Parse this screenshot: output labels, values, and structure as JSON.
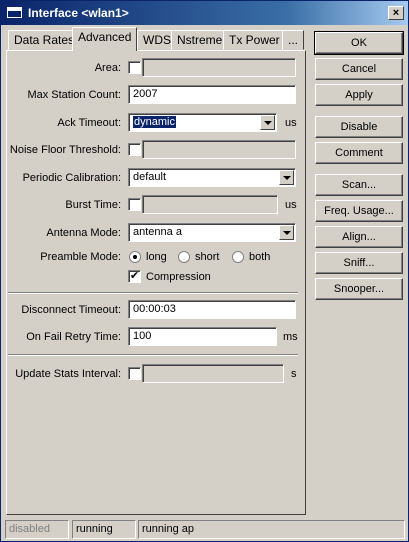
{
  "window": {
    "title": "Interface <wlan1>",
    "close_glyph": "×"
  },
  "tabs": [
    {
      "label": "Data Rates"
    },
    {
      "label": "Advanced"
    },
    {
      "label": "WDS"
    },
    {
      "label": "Nstreme"
    },
    {
      "label": "Tx Power"
    },
    {
      "label": "..."
    }
  ],
  "active_tab": "Advanced",
  "form": {
    "area": {
      "label": "Area:",
      "value": ""
    },
    "max_station_count": {
      "label": "Max Station Count:",
      "value": "2007"
    },
    "ack_timeout": {
      "label": "Ack Timeout:",
      "value": "dynamic",
      "unit": "us"
    },
    "noise_floor_threshold": {
      "label": "Noise Floor Threshold:",
      "value": ""
    },
    "periodic_calibration": {
      "label": "Periodic Calibration:",
      "value": "default"
    },
    "burst_time": {
      "label": "Burst Time:",
      "value": "",
      "unit": "us"
    },
    "antenna_mode": {
      "label": "Antenna Mode:",
      "value": "antenna a"
    },
    "preamble_mode": {
      "label": "Preamble Mode:",
      "options": [
        "long",
        "short",
        "both"
      ],
      "selected": "long"
    },
    "compression": {
      "label": "Compression",
      "checked": true,
      "check_glyph": "✔"
    },
    "disconnect_timeout": {
      "label": "Disconnect Timeout:",
      "value": "00:00:03"
    },
    "on_fail_retry_time": {
      "label": "On Fail Retry Time:",
      "value": "100",
      "unit": "ms"
    },
    "update_stats_interval": {
      "label": "Update Stats Interval:",
      "value": "",
      "unit": "s"
    }
  },
  "buttons": [
    "OK",
    "Cancel",
    "Apply",
    "Disable",
    "Comment",
    "Scan...",
    "Freq. Usage...",
    "Align...",
    "Sniff...",
    "Snooper..."
  ],
  "status": [
    "disabled",
    "running",
    "running ap"
  ],
  "colors": {
    "titlebar": "#0a246a",
    "window_bg": "#d4d0c8",
    "selection": "#0a246a"
  }
}
